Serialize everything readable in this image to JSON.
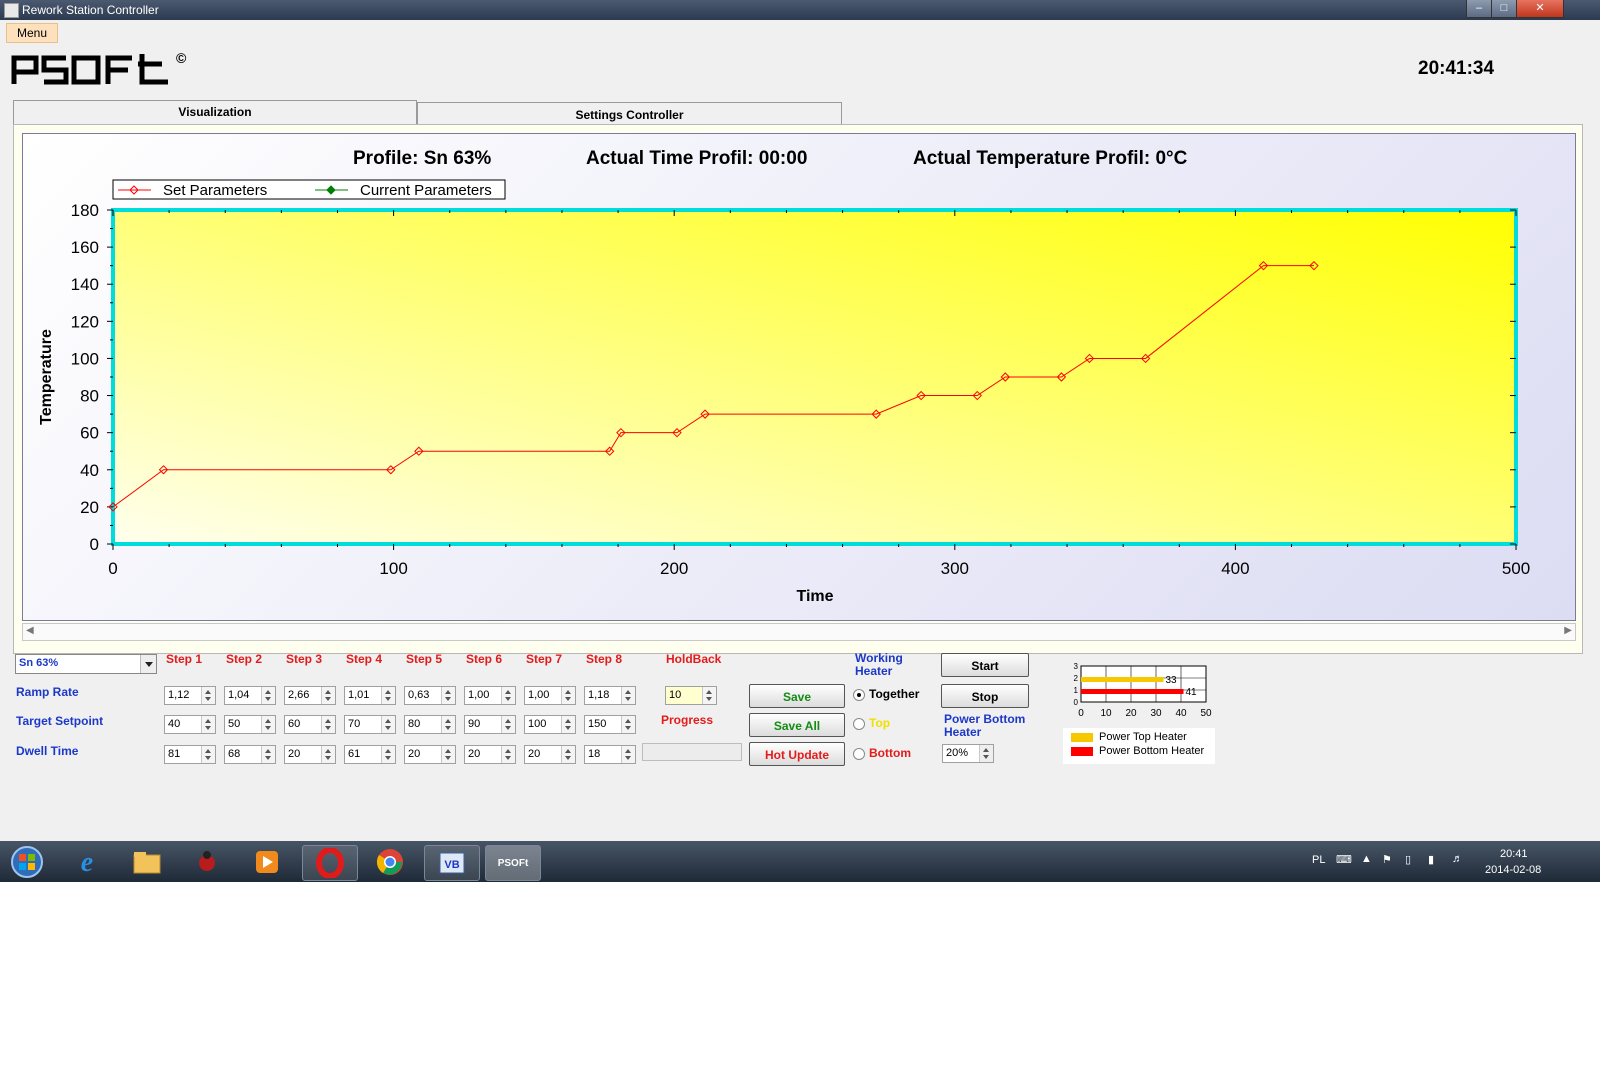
{
  "window": {
    "title": "Rework Station Controller"
  },
  "menu": {
    "label": "Menu"
  },
  "header": {
    "logo_text": "PSOFt",
    "copyright": "©",
    "clock": "20:41:34"
  },
  "tabs": [
    {
      "label": "Visualization",
      "active": true
    },
    {
      "label": "Settings Controller",
      "active": false
    }
  ],
  "chart_header": {
    "profile": "Profile: Sn 63%",
    "time": "Actual Time Profil: 00:00",
    "temperature": "Actual Temperature Profil: 0°C"
  },
  "chart_data": {
    "type": "line",
    "xlabel": "Time",
    "ylabel": "Temperature",
    "xlim": [
      0,
      500
    ],
    "ylim": [
      0,
      180
    ],
    "xticks": [
      0,
      100,
      200,
      300,
      400,
      500
    ],
    "yticks": [
      0,
      20,
      40,
      60,
      80,
      100,
      120,
      140,
      160,
      180
    ],
    "legend_placement": "top-left",
    "series": [
      {
        "name": "Set Parameters",
        "color": "#ff0000",
        "x": [
          0,
          18,
          99,
          109,
          177,
          181,
          201,
          211,
          272,
          288,
          308,
          318,
          338,
          348,
          368,
          410,
          428
        ],
        "y": [
          20,
          40,
          40,
          50,
          50,
          60,
          60,
          70,
          70,
          80,
          80,
          90,
          90,
          100,
          100,
          150,
          150
        ]
      },
      {
        "name": "Current Parameters",
        "color": "#008000",
        "x": [],
        "y": []
      }
    ]
  },
  "controls": {
    "profile_select": "Sn 63%",
    "steps": [
      "Step 1",
      "Step 2",
      "Step 3",
      "Step 4",
      "Step 5",
      "Step 6",
      "Step 7",
      "Step 8"
    ],
    "row_labels": {
      "ramp": "Ramp Rate",
      "target": "Target Setpoint",
      "dwell": "Dwell Time"
    },
    "ramp_rate": [
      "1,12",
      "1,04",
      "2,66",
      "1,01",
      "0,63",
      "1,00",
      "1,00",
      "1,18"
    ],
    "target_setpoint": [
      "40",
      "50",
      "60",
      "70",
      "80",
      "90",
      "100",
      "150"
    ],
    "dwell_time": [
      "81",
      "68",
      "20",
      "61",
      "20",
      "20",
      "20",
      "18"
    ],
    "holdback_label": "HoldBack",
    "holdback_value": "10",
    "progress_label": "Progress",
    "progress": 0,
    "buttons": {
      "save": "Save",
      "save_all": "Save All",
      "hot_update": "Hot Update",
      "start": "Start",
      "stop": "Stop"
    },
    "working_heater_label": "Working Heater",
    "radios": {
      "together": "Together",
      "top": "Top",
      "bottom": "Bottom"
    },
    "power_bottom_label": "Power Bottom Heater",
    "power_bottom_value": "20%"
  },
  "power_chart": {
    "yticks": [
      "3",
      "2",
      "1",
      "0"
    ],
    "xticks": [
      "0",
      "10",
      "20",
      "30",
      "40",
      "50"
    ],
    "top_value": 33,
    "bottom_value": 41,
    "top_label": "33",
    "bottom_label": "41",
    "top_color": "#f5c800",
    "bottom_color": "#ff0000",
    "legend_top": "Power Top Heater",
    "legend_bottom": "Power Bottom Heater"
  },
  "taskbar": {
    "lang": "PL",
    "time": "20:41",
    "date": "2014-02-08",
    "active_app": "PSOFt"
  }
}
